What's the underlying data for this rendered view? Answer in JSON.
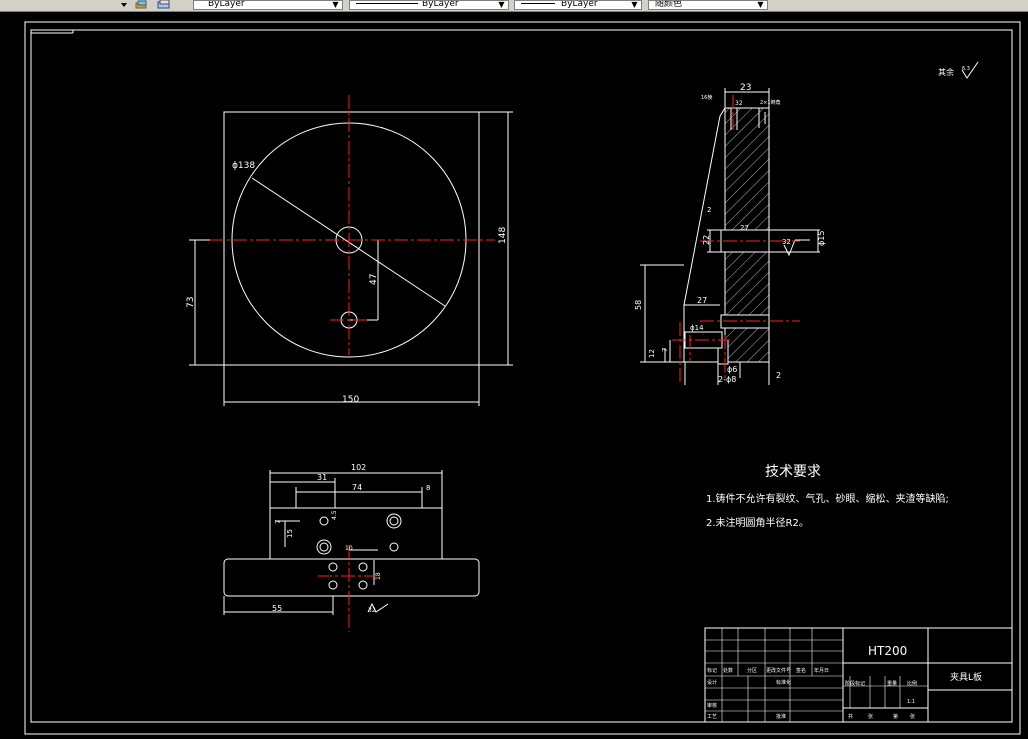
{
  "toolbar": {
    "layer_combo": {
      "value": "ByLayer",
      "icon": "dropdown-arrow"
    },
    "linetype_combo": {
      "value": "ByLayer"
    },
    "lineweight_combo": {
      "value": "ByLayer"
    },
    "color_combo": {
      "value": "随颜色"
    }
  },
  "drawing": {
    "front_view": {
      "dim_diameter": "ϕ138",
      "dim_width": "150",
      "dim_height": "148",
      "dim_left": "73",
      "dim_hole": "47"
    },
    "side_view": {
      "dim_top": "23",
      "dim_flat": "16棱",
      "dim_top_detail": "32",
      "dim_top_right": "2×1倒角",
      "dim_2a": "2",
      "dim_27a": "27",
      "dim_22": "22",
      "dim_32": "32",
      "dim_d15": "ϕ15",
      "dim_58": "58",
      "dim_27b": "27",
      "dim_d14": "ϕ14",
      "dim_7": "7",
      "dim_12": "12",
      "dim_d6": "ϕ6",
      "dim_2d8": "2-ϕ8",
      "dim_2b": "2"
    },
    "bottom_view": {
      "dim_102": "102",
      "dim_31": "31",
      "dim_74": "74",
      "dim_8": "8",
      "dim_45": "4.5",
      "dim_7": "7",
      "dim_15": "15",
      "dim_10": "10",
      "dim_18": "18",
      "dim_55": "55",
      "dim_32": "32"
    },
    "roughness_note": "其余",
    "roughness_symbol": "6.3",
    "tech_req": {
      "title": "技术要求",
      "line1": "1.铸件不允许有裂纹、气孔、砂眼、缩松、夹渣等缺陷;",
      "line2": "2.未注明圆角半径R2。"
    },
    "title_block": {
      "material": "HT200",
      "part_name": "夹具L板",
      "labels": [
        "标记",
        "处数",
        "分区",
        "更改文件号",
        "签名",
        "年月日",
        "设计",
        "标准化",
        "阶段标记",
        "重量",
        "比例",
        "审核",
        "工艺",
        "批准",
        "共",
        "张",
        "第",
        "张"
      ],
      "scale": "1:1"
    }
  },
  "colors": {
    "background": "#000000",
    "lines": "#ffffff",
    "centerline": "#ff0000",
    "toolbar": "#d4d0c8"
  }
}
